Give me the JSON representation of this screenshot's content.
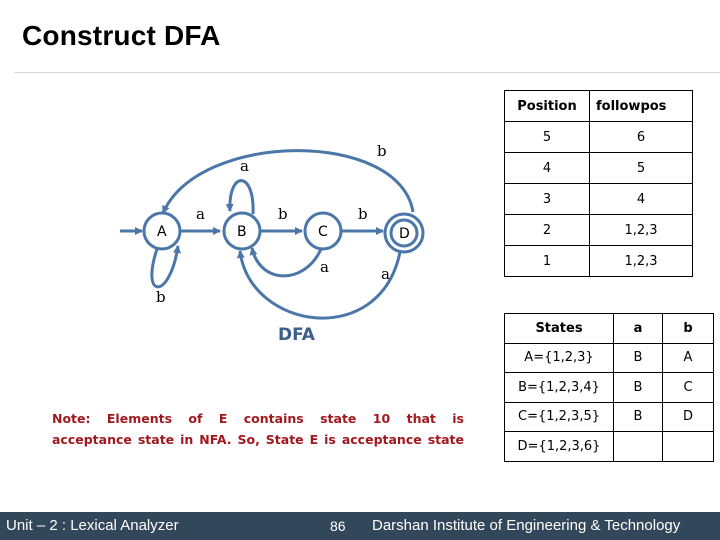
{
  "slide": {
    "title": "Construct DFA",
    "dfa_caption": "DFA",
    "note_lines": [
      "Note: Elements of E contains state 10 that is",
      "acceptance state in NFA. So, State E is acceptance state"
    ]
  },
  "diagram": {
    "states": [
      {
        "id": "A",
        "label": "A",
        "start": true,
        "accepting": false
      },
      {
        "id": "B",
        "label": "B",
        "start": false,
        "accepting": false
      },
      {
        "id": "C",
        "label": "C",
        "start": false,
        "accepting": false
      },
      {
        "id": "D",
        "label": "D",
        "start": false,
        "accepting": true
      }
    ],
    "transitions": [
      {
        "from": "A",
        "to": "B",
        "symbol": "a"
      },
      {
        "from": "A",
        "to": "A",
        "symbol": "b"
      },
      {
        "from": "B",
        "to": "B",
        "symbol": "a"
      },
      {
        "from": "B",
        "to": "C",
        "symbol": "b"
      },
      {
        "from": "C",
        "to": "B",
        "symbol": "a"
      },
      {
        "from": "C",
        "to": "D",
        "symbol": "b"
      },
      {
        "from": "D",
        "to": "B",
        "symbol": "a"
      },
      {
        "from": "D",
        "to": "A",
        "symbol": "b"
      }
    ],
    "edge_color": "#4a76a8"
  },
  "followpos_table": {
    "headers": [
      "Position",
      "followpos"
    ],
    "rows": [
      [
        "5",
        "6"
      ],
      [
        "4",
        "5"
      ],
      [
        "3",
        "4"
      ],
      [
        "2",
        "1,2,3"
      ],
      [
        "1",
        "1,2,3"
      ]
    ]
  },
  "states_table": {
    "headers": [
      "States",
      "a",
      "b"
    ],
    "rows": [
      [
        "A={1,2,3}",
        "B",
        "A"
      ],
      [
        "B={1,2,3,4}",
        "B",
        "C"
      ],
      [
        "C={1,2,3,5}",
        "B",
        "D"
      ],
      [
        "D={1,2,3,6}",
        "",
        ""
      ]
    ]
  },
  "footer": {
    "unit": "Unit – 2 : Lexical Analyzer",
    "page": "86",
    "institute": "Darshan Institute of Engineering & Technology"
  }
}
